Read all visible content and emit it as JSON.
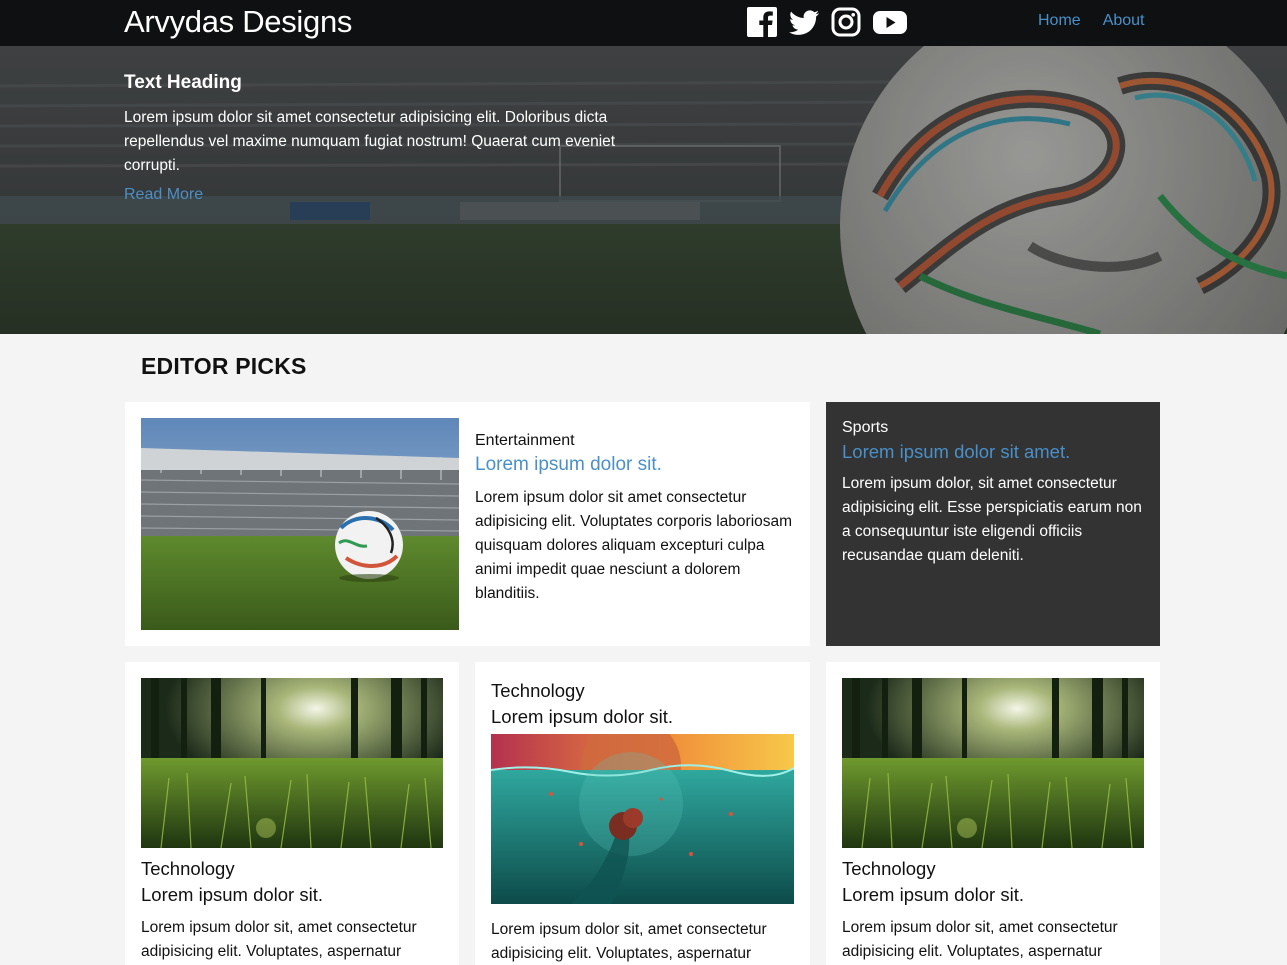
{
  "header": {
    "brand": "Arvydas Designs",
    "social": [
      {
        "name": "facebook-icon"
      },
      {
        "name": "twitter-icon"
      },
      {
        "name": "instagram-icon"
      },
      {
        "name": "youtube-icon"
      }
    ],
    "nav": {
      "home": "Home",
      "about": "About"
    },
    "colors": {
      "bar": "#0f1011",
      "link": "#4a90c8"
    }
  },
  "hero": {
    "heading": "Text Heading",
    "body": "Lorem ipsum dolor sit amet consectetur adipisicing elit. Doloribus dicta repellendus vel maxime numquam fugiat nostrum! Quaerat cum eveniet corrupti.",
    "link": "Read More"
  },
  "section": {
    "title": "EDITOR PICKS"
  },
  "cards": {
    "featured": {
      "category": "Entertainment",
      "title": "Lorem ipsum dolor sit.",
      "body": "Lorem ipsum dolor sit amet consectetur adipisicing elit. Voluptates corporis laboriosam quisquam dolores aliquam excepturi culpa animi impedit quae nesciunt a dolorem blanditiis."
    },
    "sports": {
      "category": "Sports",
      "title": "Lorem ipsum dolor sit amet.",
      "body": "Lorem ipsum dolor, sit amet consectetur adipisicing elit. Esse perspiciatis earum non a consequuntur iste eligendi officiis recusandae quam deleniti."
    },
    "tech1": {
      "category": "Technology",
      "title": "Lorem ipsum dolor sit.",
      "body": "Lorem ipsum dolor sit, amet consectetur adipisicing elit. Voluptates, aspernatur"
    },
    "tech2": {
      "category": "Technology",
      "title": "Lorem ipsum dolor sit.",
      "body": "Lorem ipsum dolor sit, amet consectetur adipisicing elit. Voluptates, aspernatur"
    },
    "tech3": {
      "category": "Technology",
      "title": "Lorem ipsum dolor sit.",
      "body": "Lorem ipsum dolor sit, amet consectetur adipisicing elit. Voluptates, aspernatur"
    }
  }
}
